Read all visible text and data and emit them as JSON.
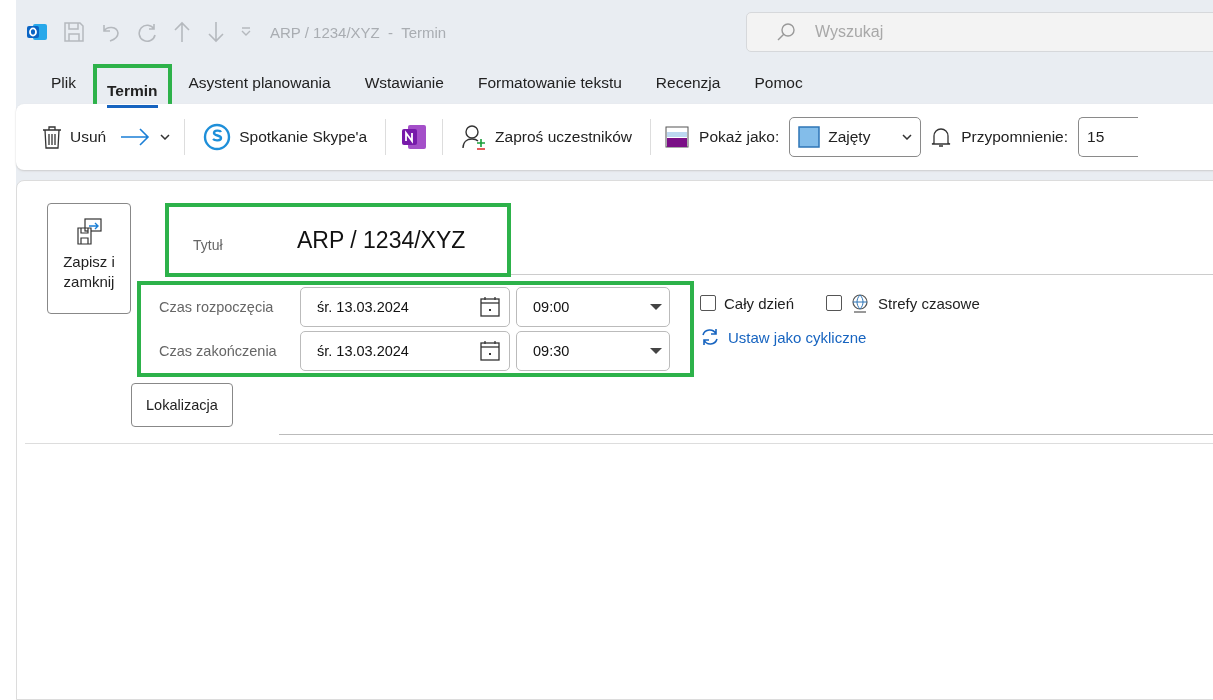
{
  "window": {
    "title": "ARP / 1234/XYZ  -  Termin"
  },
  "search": {
    "placeholder": "Wyszukaj"
  },
  "tabs": [
    {
      "label": "Plik",
      "selected": false,
      "highlighted": false
    },
    {
      "label": "Termin",
      "selected": true,
      "highlighted": true
    },
    {
      "label": "Asystent planowania",
      "selected": false,
      "highlighted": false
    },
    {
      "label": "Wstawianie",
      "selected": false,
      "highlighted": false
    },
    {
      "label": "Formatowanie tekstu",
      "selected": false,
      "highlighted": false
    },
    {
      "label": "Recenzja",
      "selected": false,
      "highlighted": false
    },
    {
      "label": "Pomoc",
      "selected": false,
      "highlighted": false
    }
  ],
  "ribbon": {
    "delete": "Usuń",
    "skype": "Spotkanie Skype'a",
    "invite": "Zaproś uczestników",
    "show_as_label": "Pokaż jako:",
    "show_as_value": "Zajęty",
    "reminder_label": "Przypomnienie:",
    "reminder_value": "15"
  },
  "form": {
    "save_close": "Zapisz i zamknij",
    "title_label": "Tytuł",
    "title_value": "ARP / 1234/XYZ",
    "title_highlighted": true,
    "times_highlighted": true,
    "times": [
      {
        "label": "Czas rozpoczęcia",
        "date": "śr. 13.03.2024",
        "time": "09:00"
      },
      {
        "label": "Czas zakończenia",
        "date": "śr. 13.03.2024",
        "time": "09:30"
      }
    ],
    "all_day": {
      "label": "Cały dzień",
      "checked": false
    },
    "time_zones": {
      "label": "Strefy czasowe",
      "checked": false
    },
    "recurrence": "Ustaw jako cykliczne",
    "location": "Lokalizacja"
  }
}
